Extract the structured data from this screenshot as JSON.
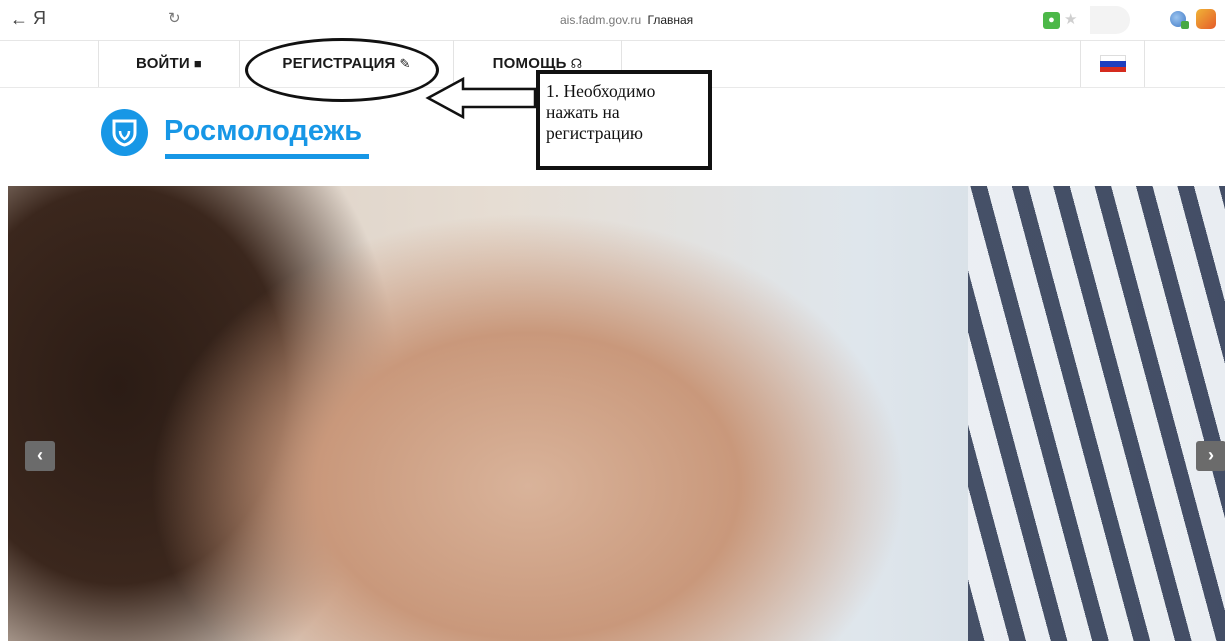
{
  "browser": {
    "back_icon": "←",
    "brand": "Я",
    "reload_icon": "↻",
    "url_domain": "ais.fadm.gov.ru",
    "page_title": "Главная",
    "lock_icon": "🔒",
    "star_icon": "★"
  },
  "nav": {
    "login_label": "ВОЙТИ",
    "login_icon": "🔒",
    "register_label": "РЕГИСТРАЦИЯ",
    "register_icon": "✎",
    "help_label": "ПОМОЩЬ",
    "help_icon": "☊",
    "lang_flag_colors": [
      "#ffffff",
      "#1e3fbf",
      "#d52b1e"
    ]
  },
  "logo": {
    "text": "Росмолодежь",
    "color": "#1797e6"
  },
  "annotation": {
    "callout_text": "1. Необходимо нажать на регистрацию"
  },
  "carousel": {
    "prev_icon": "‹",
    "next_icon": "›"
  }
}
